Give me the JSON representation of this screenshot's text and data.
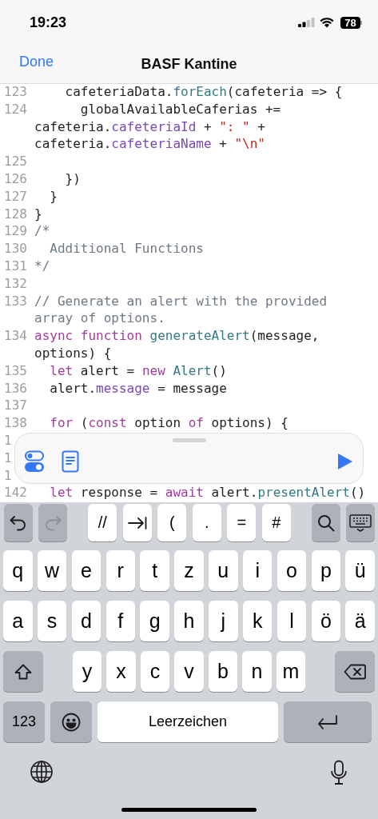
{
  "status_bar": {
    "time": "19:23",
    "battery": "78"
  },
  "nav_bar": {
    "done": "Done",
    "title": "BASF Kantine"
  },
  "code_lines": [
    {
      "number": "123",
      "rows": [
        {
          "segments": [
            {
              "text": "    cafeteriaData.",
              "kind": "plain"
            },
            {
              "text": "forEach",
              "kind": "function"
            },
            {
              "text": "(cafeteria => {",
              "kind": "plain"
            }
          ]
        }
      ]
    },
    {
      "number": "124",
      "rows": [
        {
          "segments": [
            {
              "text": "      globalAvailableCaferias +=",
              "kind": "plain"
            }
          ]
        },
        {
          "segments": [
            {
              "text": "cafeteria.",
              "kind": "plain"
            },
            {
              "text": "cafeteriaId",
              "kind": "member"
            },
            {
              "text": " + ",
              "kind": "plain"
            },
            {
              "text": "\": \"",
              "kind": "string"
            },
            {
              "text": " +",
              "kind": "plain"
            }
          ]
        },
        {
          "segments": [
            {
              "text": "cafeteria.",
              "kind": "plain"
            },
            {
              "text": "cafeteriaName",
              "kind": "member"
            },
            {
              "text": " + ",
              "kind": "plain"
            },
            {
              "text": "\"\\n\"",
              "kind": "string"
            }
          ]
        }
      ]
    },
    {
      "number": "125"
    },
    {
      "number": "126",
      "rows": [
        {
          "segments": [
            {
              "text": "    })",
              "kind": "plain"
            }
          ]
        }
      ]
    },
    {
      "number": "127",
      "rows": [
        {
          "segments": [
            {
              "text": "  }",
              "kind": "plain"
            }
          ]
        }
      ]
    },
    {
      "number": "128",
      "rows": [
        {
          "segments": [
            {
              "text": "}",
              "kind": "plain"
            }
          ]
        }
      ]
    },
    {
      "number": "129",
      "rows": [
        {
          "segments": [
            {
              "text": "/*",
              "kind": "comment"
            }
          ]
        }
      ]
    },
    {
      "number": "130",
      "rows": [
        {
          "segments": [
            {
              "text": "  Additional Functions",
              "kind": "comment"
            }
          ]
        }
      ]
    },
    {
      "number": "131",
      "rows": [
        {
          "segments": [
            {
              "text": "*/",
              "kind": "comment"
            }
          ]
        }
      ]
    },
    {
      "number": "132"
    },
    {
      "number": "133",
      "rows": [
        {
          "segments": [
            {
              "text": "// Generate an alert with the provided",
              "kind": "comment"
            }
          ]
        },
        {
          "segments": [
            {
              "text": "array of options.",
              "kind": "comment"
            }
          ]
        }
      ]
    },
    {
      "number": "134",
      "rows": [
        {
          "segments": [
            {
              "text": "async function",
              "kind": "keyword"
            },
            {
              "text": " generateAlert",
              "kind": "function"
            },
            {
              "text": "(message,",
              "kind": "plain"
            }
          ]
        },
        {
          "segments": [
            {
              "text": "options) {",
              "kind": "plain"
            }
          ]
        }
      ]
    },
    {
      "number": "135",
      "rows": [
        {
          "segments": [
            {
              "text": "  let",
              "kind": "keyword"
            },
            {
              "text": " alert = ",
              "kind": "plain"
            },
            {
              "text": "new",
              "kind": "keyword"
            },
            {
              "text": " Alert",
              "kind": "function"
            },
            {
              "text": "()",
              "kind": "plain"
            }
          ]
        }
      ]
    },
    {
      "number": "136",
      "rows": [
        {
          "segments": [
            {
              "text": "  alert.",
              "kind": "plain"
            },
            {
              "text": "message",
              "kind": "member"
            },
            {
              "text": " = message",
              "kind": "plain"
            }
          ]
        }
      ]
    },
    {
      "number": "137"
    },
    {
      "number": "138",
      "rows": [
        {
          "segments": [
            {
              "text": "  for",
              "kind": "keyword"
            },
            {
              "text": " (",
              "kind": "plain"
            },
            {
              "text": "const",
              "kind": "keyword"
            },
            {
              "text": " option ",
              "kind": "plain"
            },
            {
              "text": "of",
              "kind": "keyword"
            },
            {
              "text": " options) {",
              "kind": "plain"
            }
          ]
        }
      ]
    },
    {
      "number": "1"
    },
    {
      "number": "1"
    },
    {
      "number": "1"
    },
    {
      "number": "142",
      "rows": [
        {
          "segments": [
            {
              "text": "  let",
              "kind": "keyword"
            },
            {
              "text": " response = ",
              "kind": "plain"
            },
            {
              "text": "await",
              "kind": "keyword"
            },
            {
              "text": " alert.",
              "kind": "plain"
            },
            {
              "text": "presentAlert",
              "kind": "function"
            },
            {
              "text": "()",
              "kind": "plain"
            }
          ]
        }
      ]
    }
  ],
  "keyboard": {
    "toolbar": [
      {
        "kind": "undo",
        "disabled": false
      },
      {
        "kind": "redo",
        "disabled": true
      },
      {
        "kind": "text",
        "label": "//"
      },
      {
        "kind": "tab"
      },
      {
        "kind": "text",
        "label": "("
      },
      {
        "kind": "text",
        "label": "."
      },
      {
        "kind": "text",
        "label": "="
      },
      {
        "kind": "text",
        "label": "#"
      },
      {
        "kind": "search"
      },
      {
        "kind": "dismiss"
      }
    ],
    "top_row": [
      "q",
      "w",
      "e",
      "r",
      "t",
      "z",
      "u",
      "i",
      "o",
      "p",
      "ü"
    ],
    "middle_row": [
      "a",
      "s",
      "d",
      "f",
      "g",
      "h",
      "j",
      "k",
      "l",
      "ö",
      "ä"
    ],
    "bottom_row": [
      "y",
      "x",
      "c",
      "v",
      "b",
      "n",
      "m"
    ],
    "numbers_key": "123",
    "space_key": "Leerzeichen"
  }
}
